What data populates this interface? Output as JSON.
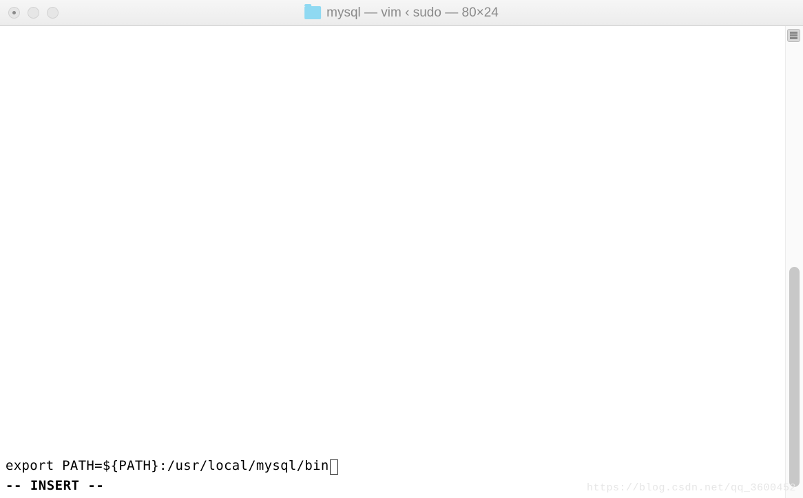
{
  "titlebar": {
    "title": "mysql — vim ‹ sudo — 80×24"
  },
  "terminal": {
    "content_line": "export PATH=${PATH}:/usr/local/mysql/bin",
    "mode_line": "-- INSERT --"
  },
  "watermark": "https://blog.csdn.net/qq_3600452"
}
